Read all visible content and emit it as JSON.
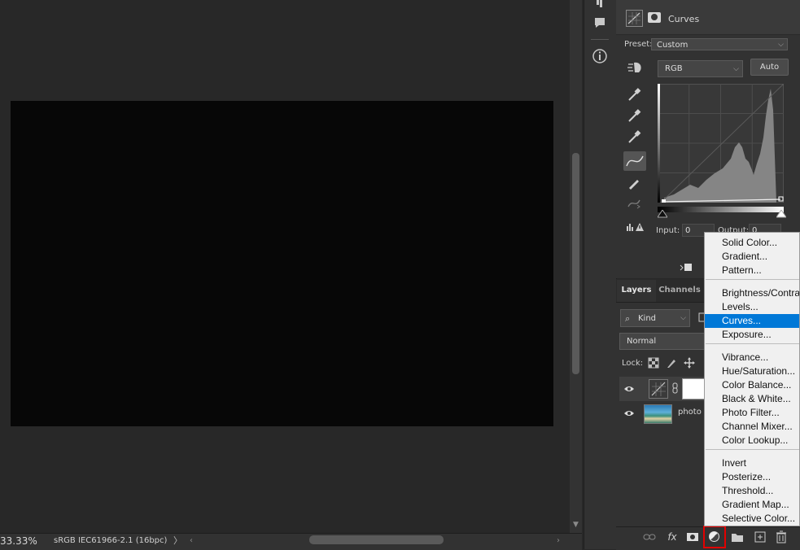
{
  "status": {
    "zoom": "33.33%",
    "profile": "sRGB IEC61966-2.1 (16bpc)",
    "arrow": "〉",
    "left_arrow": "‹",
    "right_arrow": "›"
  },
  "properties": {
    "title": "Curves",
    "preset_label": "Preset:",
    "preset_value": "Custom",
    "channel": "RGB",
    "auto_label": "Auto",
    "input_label": "Input:",
    "input_value": "0",
    "output_label": "Output:",
    "output_value": "0"
  },
  "layers": {
    "tabs": [
      "Layers",
      "Channels"
    ],
    "kind_label": "Kind",
    "blend_mode": "Normal",
    "lock_label": "Lock:",
    "layer_names": [
      "",
      "photo"
    ]
  },
  "menu": {
    "groups": [
      [
        "Solid Color...",
        "Gradient...",
        "Pattern..."
      ],
      [
        "Brightness/Contrast...",
        "Levels...",
        "Curves...",
        "Exposure..."
      ],
      [
        "Vibrance...",
        "Hue/Saturation...",
        "Color Balance...",
        "Black & White...",
        "Photo Filter...",
        "Channel Mixer...",
        "Color Lookup..."
      ],
      [
        "Invert",
        "Posterize...",
        "Threshold...",
        "Gradient Map...",
        "Selective Color..."
      ]
    ],
    "selected": "Curves..."
  },
  "icons": {
    "colors": {
      "panel": "#323232",
      "menu_selected": "#0078d7",
      "highlight_border": "#e20000"
    }
  }
}
